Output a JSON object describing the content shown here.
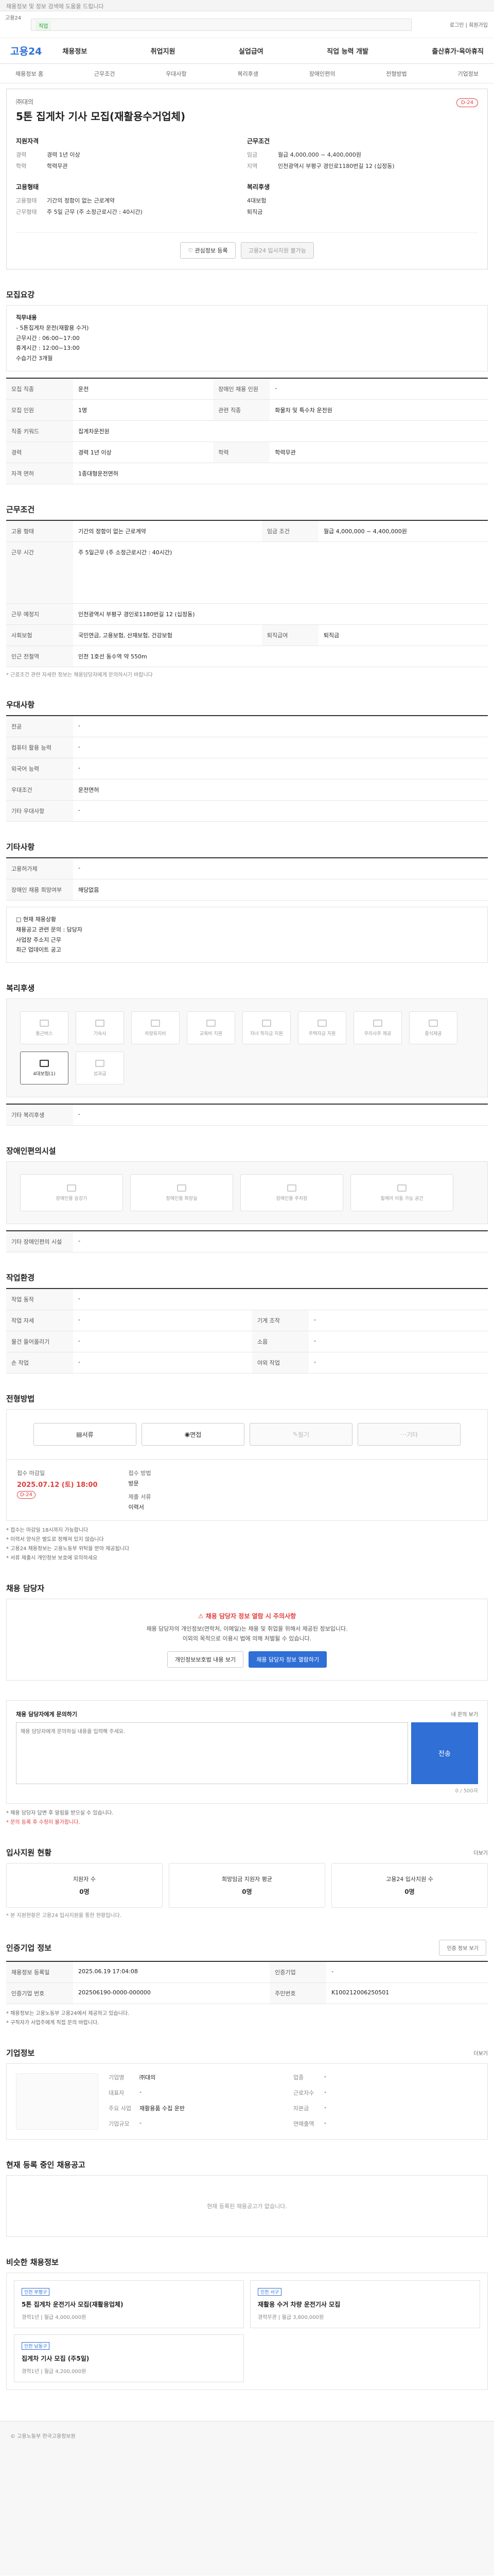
{
  "notice": "채용정보 및 정보 검색에 도움을 드립니다",
  "topbar": {
    "mini": "고용24",
    "tag": "직업",
    "right": "로그인 | 회원가입"
  },
  "gnb": {
    "logo": "고용24",
    "menu": [
      "채용정보",
      "취업지원",
      "실업급여",
      "직업 능력 개발",
      "출산휴가·육아휴직"
    ]
  },
  "subnav": [
    "채용정보 홈",
    "근무조건",
    "우대사항",
    "복리후생",
    "장애인편의",
    "전형방법",
    "기업정보"
  ],
  "title": {
    "company": "㈜대의",
    "name": "5톤 집게차 기사 모집(재활용수거업체)",
    "dday": "D-24",
    "left_head": "지원자격",
    "left": [
      [
        "경력",
        "경력 1년 이상"
      ],
      [
        "학력",
        "학력무관"
      ]
    ],
    "right_head": "근무조건",
    "right": [
      [
        "임금",
        "월급 4,000,000 ~ 4,400,000원"
      ],
      [
        "지역",
        "인천광역시 부평구 경인로1180번길 12 (십정동)"
      ]
    ],
    "left2_head": "고용형태",
    "left2": [
      [
        "고용형태",
        "기간의 정함이 없는 근로계약"
      ],
      [
        "근무형태",
        "주 5일 근무 (주 소정근로시간 : 40시간)"
      ]
    ],
    "right2_head": "복리후생",
    "right2": [
      [
        "",
        "4대보험"
      ],
      [
        "",
        "퇴직금"
      ]
    ],
    "btn_scrap": "관심정보 등록",
    "btn_apply": "고용24 입사지원 불가능"
  },
  "recruit": {
    "title": "모집요강",
    "content": [
      "직무내용",
      "- 5톤집게차 운전(재활용 수거)",
      "근무시간 : 06:00~17:00",
      "휴게시간 : 12:00~13:00",
      "수습기간 3개월"
    ],
    "rows": [
      [
        "모집 직종",
        "운전",
        "장애인 채용 인원",
        "-"
      ],
      [
        "모집 인원",
        "1명",
        "관련 직종",
        "화물차 및 특수차 운전원"
      ],
      [
        "직종 키워드",
        "집게차운전원",
        "",
        ""
      ],
      [
        "경력",
        "경력 1년 이상",
        "학력",
        "학력무관"
      ],
      [
        "자격 면허",
        "1종대형운전면허",
        "",
        ""
      ]
    ]
  },
  "cond": {
    "title": "근무조건",
    "rows": [
      [
        "고용 형태",
        "기간의 정함이 없는 근로계약",
        "임금 조건",
        "월급 4,000,000 ~ 4,400,000원"
      ],
      [
        "근무 시간",
        "주 5일근무 (주 소정근로시간 : 40시간)",
        "",
        ""
      ],
      [
        "근무 예정지",
        "인천광역시 부평구 경인로1180번길 12 (십정동)",
        "",
        ""
      ],
      [
        "사회보험",
        "국민연금, 고용보험, 산재보험, 건강보험",
        "퇴직급여",
        "퇴직금"
      ],
      [
        "인근 전철역",
        "인천 1호선 동수역 약 550m",
        "",
        ""
      ]
    ],
    "note": "* 근로조건 관련 자세한 정보는 채용담당자에게 문의하시기 바랍니다"
  },
  "pref": {
    "title": "우대사항",
    "rows": [
      [
        "전공",
        "-"
      ],
      [
        "컴퓨터 활용 능력",
        "-"
      ],
      [
        "외국어 능력",
        "-"
      ],
      [
        "우대조건",
        "운전면허"
      ],
      [
        "기타 우대사항",
        "-"
      ]
    ]
  },
  "etc": {
    "title": "기타사항",
    "rows": [
      [
        "고용허가제",
        "-"
      ],
      [
        "장애인 채용 희망여부",
        "해당없음"
      ]
    ]
  },
  "etcbox": [
    "□ 현재 채용상황",
    "채용공고 관련 문의 : 담당자",
    "사업장 주소지 근무",
    "최근 업데이트 공고"
  ],
  "welfare": {
    "title": "복리후생",
    "items": [
      "통근버스",
      "기숙사",
      "차량유지비",
      "교육비 지원",
      "자녀 학자금 지원",
      "주택자금 지원",
      "우리사주 제공",
      "중식제공",
      "4대보험(1)",
      "성과급"
    ]
  },
  "welfare_etc": {
    "label": "기타 복리후생",
    "value": "-"
  },
  "disab": {
    "title": "장애인편의시설",
    "items": [
      "장애인용 승강기",
      "장애인용 화장실",
      "장애인용 주차장",
      "휠체어 이동 가능 공간"
    ]
  },
  "disab_etc": {
    "label": "기타 장애인편의 시설",
    "value": "-"
  },
  "env": {
    "title": "작업환경",
    "rows": [
      [
        "작업 동작",
        "-",
        "",
        ""
      ],
      [
        "작업 자세",
        "-",
        "기계 조작",
        "-"
      ],
      [
        "물건 들어올리기",
        "-",
        "소음",
        "-"
      ],
      [
        "손 작업",
        "-",
        "야외 작업",
        "-"
      ]
    ]
  },
  "method": {
    "title": "전형방법",
    "btns": [
      "서류",
      "면접",
      "필기",
      "기타"
    ],
    "deadline_label": "접수 마감일",
    "deadline": "2025.07.12 (토) 18:00",
    "deadline_badge": "D-24",
    "method_label": "접수 방법",
    "method_value": "방문",
    "docs_label": "제출 서류",
    "docs_value": "이력서",
    "bullets": [
      "* 접수는 마감일 18시까지 가능합니다",
      "* 이력서 양식은 별도로 정해져 있지 않습니다",
      "* 고용24 채용정보는 고용노동부 위탁을 받아 제공됩니다",
      "* 서류 제출시 개인정보 보호에 유의하세요"
    ]
  },
  "contact": {
    "title": "채용 담당자",
    "warn": "채용 담당자 정보 열람 시 주의사항",
    "warn_text": [
      "채용 담당자의 개인정보(연락처, 이메일)는 채용 및 취업을 위해서 제공된 정보입니다.",
      "이외의 목적으로 이용시 법에 의해 처벌될 수 있습니다."
    ],
    "b1": "개인정보보호법 내용 보기",
    "b2": "채용 담당자 정보 열람하기"
  },
  "qna": {
    "title": "채용 담당자에게 문의하기",
    "right": "내 문의 보기",
    "placeholder": "채용 담당자에게 문의하실 내용을 입력해 주세요.",
    "send": "전송",
    "count": "0 / 500자",
    "notes": [
      "* 채용 담당자 답변 후 알림을 받으실 수 있습니다.",
      "* 문의 등록 후 수정이 불가합니다."
    ]
  },
  "apply_info": {
    "title": "입사지원 현황",
    "more": "더보기",
    "cards": [
      [
        "지원자 수",
        "0명"
      ],
      [
        "희망임금 지원자 평균",
        "0명"
      ],
      [
        "고용24 입사지원 수",
        "0명"
      ]
    ],
    "note": "* 본 지원현황은 고용24 입사지원을 통한 현황입니다."
  },
  "certify": {
    "title": "인증기업 정보",
    "more": "인증 정보 보기",
    "rows": [
      [
        "채용정보 등록일",
        "2025.06.19 17:04:08",
        "인증기업",
        "-"
      ],
      [
        "인증기업 번호",
        "202506190-0000-000000",
        "주민번호",
        "K100212006250501"
      ]
    ],
    "notes": [
      "* 채용정보는 고용노동부 고용24에서 제공하고 있습니다.",
      "* 구직자가 사업주에게 직접 문의 바랍니다."
    ]
  },
  "company": {
    "title": "기업정보",
    "more": "더보기",
    "rows": [
      [
        "기업명",
        "㈜대의",
        "업종",
        "-"
      ],
      [
        "대표자",
        "-",
        "근로자수",
        "-"
      ],
      [
        "주요 사업",
        "재활용품 수집 운반",
        "자본금",
        "-"
      ],
      [
        "기업규모",
        "-",
        "연매출액",
        "-"
      ]
    ]
  },
  "other": {
    "title": "현재 등록 중인 채용공고",
    "empty": "현재 등록된 채용공고가 없습니다."
  },
  "ads": {
    "title": "비슷한 채용정보",
    "items": [
      {
        "tag": "인천 부평구",
        "title": "5톤 집게차 운전기사 모집(재활용업체)",
        "meta": "경력1년 | 월급 4,000,000원"
      },
      {
        "tag": "인천 서구",
        "title": "재활용 수거 차량 운전기사 모집",
        "meta": "경력무관 | 월급 3,800,000원"
      },
      {
        "tag": "인천 남동구",
        "title": "집게차 기사 모집 (주5일)",
        "meta": "경력1년 | 월급 4,200,000원"
      }
    ]
  },
  "footer": "© 고용노동부 한국고용정보원"
}
